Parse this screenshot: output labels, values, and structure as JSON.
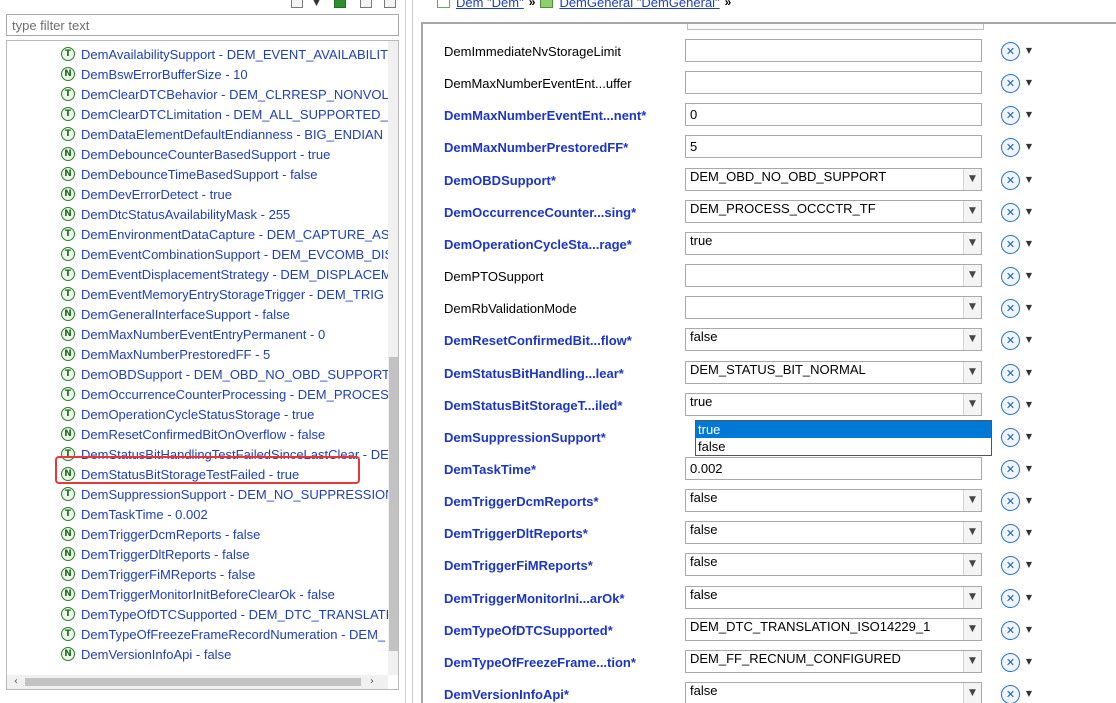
{
  "left": {
    "filter_placeholder": "type filter text",
    "tree_items": [
      {
        "icon": "T",
        "label": "DemAvailabilitySupport - DEM_EVENT_AVAILABILITY"
      },
      {
        "icon": "N",
        "label": "DemBswErrorBufferSize - 10"
      },
      {
        "icon": "T",
        "label": "DemClearDTCBehavior - DEM_CLRRESP_NONVOLAT"
      },
      {
        "icon": "T",
        "label": "DemClearDTCLimitation - DEM_ALL_SUPPORTED_DT"
      },
      {
        "icon": "T",
        "label": "DemDataElementDefaultEndianness - BIG_ENDIAN"
      },
      {
        "icon": "N",
        "label": "DemDebounceCounterBasedSupport - true"
      },
      {
        "icon": "N",
        "label": "DemDebounceTimeBasedSupport - false"
      },
      {
        "icon": "N",
        "label": "DemDevErrorDetect - true"
      },
      {
        "icon": "N",
        "label": "DemDtcStatusAvailabilityMask - 255"
      },
      {
        "icon": "T",
        "label": "DemEnvironmentDataCapture - DEM_CAPTURE_ASY"
      },
      {
        "icon": "T",
        "label": "DemEventCombinationSupport - DEM_EVCOMB_DIS"
      },
      {
        "icon": "T",
        "label": "DemEventDisplacementStrategy - DEM_DISPLACEM"
      },
      {
        "icon": "T",
        "label": "DemEventMemoryEntryStorageTrigger - DEM_TRIG"
      },
      {
        "icon": "N",
        "label": "DemGeneralInterfaceSupport - false"
      },
      {
        "icon": "N",
        "label": "DemMaxNumberEventEntryPermanent - 0"
      },
      {
        "icon": "N",
        "label": "DemMaxNumberPrestoredFF - 5"
      },
      {
        "icon": "T",
        "label": "DemOBDSupport - DEM_OBD_NO_OBD_SUPPORT"
      },
      {
        "icon": "T",
        "label": "DemOccurrenceCounterProcessing - DEM_PROCESS"
      },
      {
        "icon": "T",
        "label": "DemOperationCycleStatusStorage - true"
      },
      {
        "icon": "N",
        "label": "DemResetConfirmedBitOnOverflow - false"
      },
      {
        "icon": "T",
        "label": "DemStatusBitHandlingTestFailedSinceLastClear - DE"
      },
      {
        "icon": "N",
        "label": "DemStatusBitStorageTestFailed - true"
      },
      {
        "icon": "T",
        "label": "DemSuppressionSupport - DEM_NO_SUPPRESSION"
      },
      {
        "icon": "T",
        "label": "DemTaskTime - 0.002"
      },
      {
        "icon": "N",
        "label": "DemTriggerDcmReports - false"
      },
      {
        "icon": "N",
        "label": "DemTriggerDltReports - false"
      },
      {
        "icon": "N",
        "label": "DemTriggerFiMReports - false"
      },
      {
        "icon": "N",
        "label": "DemTriggerMonitorInitBeforeClearOk - false"
      },
      {
        "icon": "T",
        "label": "DemTypeOfDTCSupported - DEM_DTC_TRANSLATIC"
      },
      {
        "icon": "T",
        "label": "DemTypeOfFreezeFrameRecordNumeration - DEM_"
      },
      {
        "icon": "N",
        "label": "DemVersionInfoApi - false"
      }
    ],
    "highlighted_index": 21
  },
  "breadcrumb": {
    "item1": "Dem \"Dem\"",
    "item2": "DemGeneral \"DemGeneral\"",
    "separator": "»"
  },
  "form": {
    "reset_icon": "reset-default-icon",
    "rows": [
      {
        "label": "DemImmediateNvStorageLimit",
        "bold": false,
        "type": "text",
        "value": ""
      },
      {
        "label": "DemMaxNumberEventEnt...uffer",
        "bold": false,
        "type": "text",
        "value": ""
      },
      {
        "label": "DemMaxNumberEventEnt...nent*",
        "bold": true,
        "type": "text",
        "value": "0"
      },
      {
        "label": "DemMaxNumberPrestoredFF*",
        "bold": true,
        "type": "text",
        "value": "5"
      },
      {
        "label": "DemOBDSupport*",
        "bold": true,
        "type": "combo",
        "value": "DEM_OBD_NO_OBD_SUPPORT"
      },
      {
        "label": "DemOccurrenceCounter...sing*",
        "bold": true,
        "type": "combo",
        "value": "DEM_PROCESS_OCCCTR_TF"
      },
      {
        "label": "DemOperationCycleSta...rage*",
        "bold": true,
        "type": "combo",
        "value": "true"
      },
      {
        "label": "DemPTOSupport",
        "bold": false,
        "type": "combo",
        "value": ""
      },
      {
        "label": "DemRbValidationMode",
        "bold": false,
        "type": "combo",
        "value": ""
      },
      {
        "label": "DemResetConfirmedBit...flow*",
        "bold": true,
        "type": "combo",
        "value": "false"
      },
      {
        "label": "DemStatusBitHandling...lear*",
        "bold": true,
        "type": "combo",
        "value": "DEM_STATUS_BIT_NORMAL"
      },
      {
        "label": "DemStatusBitStorageT...iled*",
        "bold": true,
        "type": "combo",
        "value": "true"
      },
      {
        "label": "DemSuppressionSupport*",
        "bold": true,
        "type": "hidden",
        "value": ""
      },
      {
        "label": "DemTaskTime*",
        "bold": true,
        "type": "text",
        "value": "0.002"
      },
      {
        "label": "DemTriggerDcmReports*",
        "bold": true,
        "type": "combo",
        "value": "false"
      },
      {
        "label": "DemTriggerDltReports*",
        "bold": true,
        "type": "combo",
        "value": "false"
      },
      {
        "label": "DemTriggerFiMReports*",
        "bold": true,
        "type": "combo",
        "value": "false"
      },
      {
        "label": "DemTriggerMonitorIni...arOk*",
        "bold": true,
        "type": "combo",
        "value": "false"
      },
      {
        "label": "DemTypeOfDTCSupported*",
        "bold": true,
        "type": "combo",
        "value": "DEM_DTC_TRANSLATION_ISO14229_1"
      },
      {
        "label": "DemTypeOfFreezeFrame...tion*",
        "bold": true,
        "type": "combo",
        "value": "DEM_FF_RECNUM_CONFIGURED"
      },
      {
        "label": "DemVersionInfoApi*",
        "bold": true,
        "type": "combo",
        "value": "false"
      }
    ],
    "dropdown": {
      "options": [
        "true",
        "false"
      ],
      "selected": "true"
    }
  }
}
